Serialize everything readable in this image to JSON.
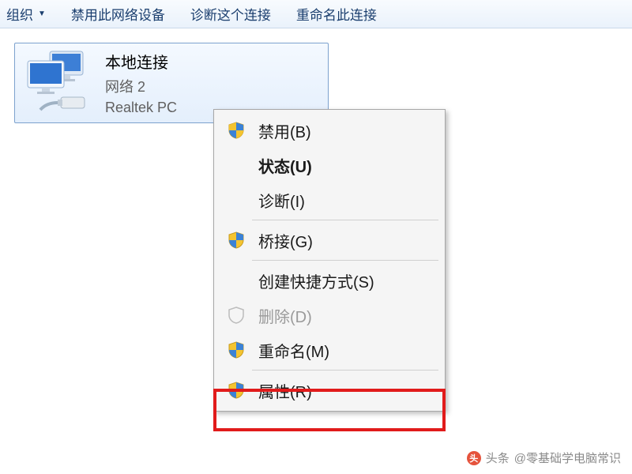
{
  "toolbar": {
    "organize": "组织",
    "disable_device": "禁用此网络设备",
    "diagnose": "诊断这个连接",
    "rename": "重命名此连接"
  },
  "network": {
    "title": "本地连接",
    "subtitle": "网络  2",
    "adapter": "Realtek PC"
  },
  "menu": {
    "disable": "禁用(B)",
    "status": "状态(U)",
    "diagnose": "诊断(I)",
    "bridge": "桥接(G)",
    "shortcut": "创建快捷方式(S)",
    "delete": "删除(D)",
    "rename": "重命名(M)",
    "properties": "属性(R)"
  },
  "watermark": {
    "prefix": "头条",
    "text": "@零基础学电脑常识"
  }
}
